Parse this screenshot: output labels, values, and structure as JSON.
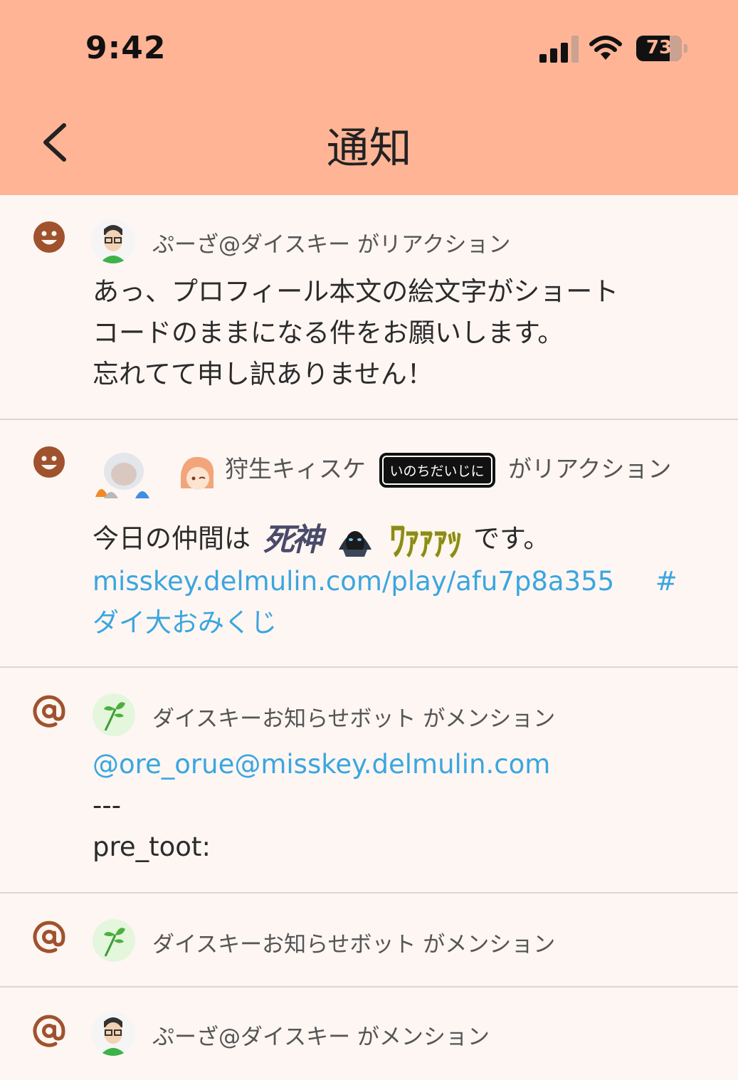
{
  "status_bar": {
    "time": "9:42",
    "battery": "73"
  },
  "nav": {
    "title": "通知"
  },
  "notifications": [
    {
      "kind": "reaction",
      "user": "ぷーざ@ダイスキー",
      "action": "がリアクション",
      "lines": [
        "あっ、プロフィール本文の絵文字がショート",
        "コードのままになる件をお願いします。",
        "忘れてて申し訳ありません！"
      ]
    },
    {
      "kind": "reaction",
      "user": "狩生キィスケ",
      "role_badge": "いのちだいじに",
      "action": "がリアクション",
      "text_prefix": "今日の仲間は",
      "emoji_1": "死神",
      "emoji_2": "ﾜｧｧｧｯ",
      "text_suffix": "です。",
      "link": "misskey.delmulin.com/play/afu7p8a355",
      "hashtag_mark": "#",
      "hashtag": "ダイ大おみくじ"
    },
    {
      "kind": "mention",
      "user": "ダイスキーお知らせボット",
      "action": "がメンション",
      "mention": "@ore_orue@misskey.delmulin.com",
      "line2": "---",
      "line3": "pre_toot:"
    },
    {
      "kind": "mention",
      "user": "ダイスキーお知らせボット",
      "action": "がメンション"
    },
    {
      "kind": "mention",
      "user": "ぷーざ@ダイスキー",
      "action": "がメンション"
    }
  ],
  "colors": {
    "header": "#ffb496",
    "background": "#fdf6f3",
    "icon": "#a0522d",
    "link": "#3aa6df"
  },
  "icons": {
    "reaction": "smiley-icon",
    "mention": "at-sign-icon",
    "back": "chevron-left-icon"
  }
}
